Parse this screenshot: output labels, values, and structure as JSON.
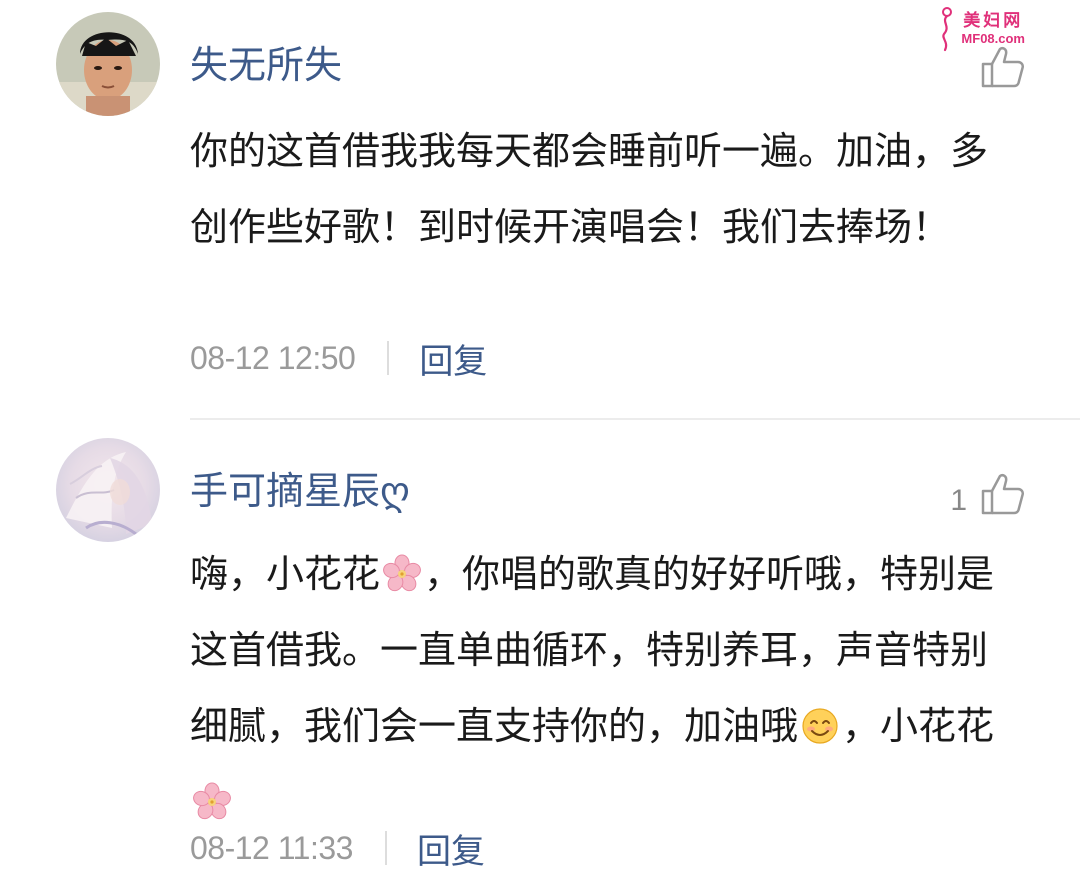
{
  "watermark": {
    "line1": "美妇网",
    "line2": "MF08.com"
  },
  "comments": [
    {
      "username": "失无所失",
      "like_count": "",
      "body": "你的这首借我我每天都会睡前听一遍。加油，多创作些好歌！到时候开演唱会！我们去捧场！",
      "time": "08-12 12:50",
      "reply_label": "回复"
    },
    {
      "username": "手可摘星辰ღ",
      "like_count": "1",
      "body_parts": [
        "嗨，小花花",
        "，你唱的歌真的好好听哦，特别是这首借我。一直单曲循环，特别养耳，声音特别细腻，我们会一直支持你的，加油哦",
        "，小花花"
      ],
      "emojis": [
        "cherry-blossom",
        "smiling-face",
        "cherry-blossom"
      ],
      "time": "08-12 11:33",
      "reply_label": "回复"
    }
  ],
  "colors": {
    "username": "#3d5a8a",
    "reply": "#3d5a8a",
    "time": "#9a9a9a",
    "text": "#1a1a1a",
    "watermark": "#e0307a"
  }
}
